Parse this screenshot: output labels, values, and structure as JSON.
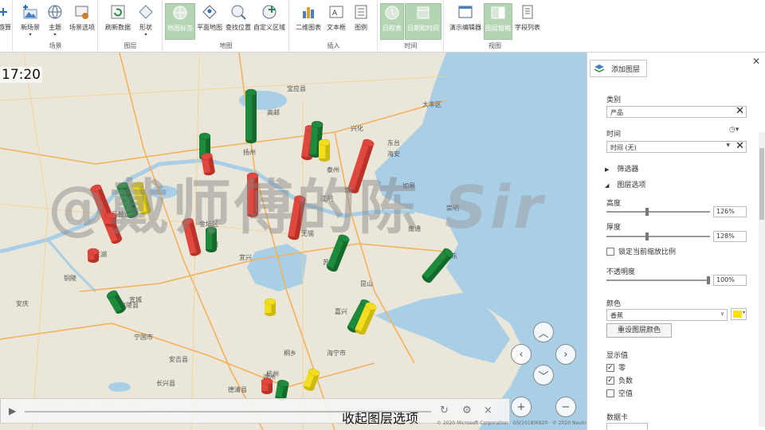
{
  "ribbon": {
    "groups": [
      {
        "label": "场景",
        "buttons": [
          {
            "label": "新场景"
          },
          {
            "label": "主题"
          },
          {
            "label": "场景选项"
          }
        ]
      },
      {
        "label": "图层",
        "buttons": [
          {
            "label": "刷新数据"
          },
          {
            "label": "形状"
          }
        ]
      },
      {
        "label": "地图",
        "buttons": [
          {
            "label": "地图标签"
          },
          {
            "label": "平面地图"
          },
          {
            "label": "查找位置"
          },
          {
            "label": "自定义区域"
          }
        ]
      },
      {
        "label": "插入",
        "buttons": [
          {
            "label": "二维图表"
          },
          {
            "label": "文本框"
          },
          {
            "label": "图例"
          }
        ]
      },
      {
        "label": "时间",
        "buttons": [
          {
            "label": "日程表"
          },
          {
            "label": "日期和时间"
          }
        ]
      },
      {
        "label": "视图",
        "buttons": [
          {
            "label": "演示编辑器"
          },
          {
            "label": "图层窗格"
          },
          {
            "label": "字段列表"
          }
        ]
      }
    ],
    "first_partial_label": "游算"
  },
  "map": {
    "clock": "17:20",
    "watermark": "@戴师傅的陈",
    "watermark_suffix": "Sir",
    "place_labels": [
      "马鞍山",
      "芜湖",
      "宁国市",
      "南陵县",
      "宣城",
      "长兴县",
      "湖州",
      "杭州",
      "德清县",
      "海宁市",
      "嘉兴",
      "苏州",
      "无锡",
      "江阴",
      "常熟",
      "扬州",
      "高邮",
      "宝应县",
      "金坛区",
      "溧阳",
      "宜兴",
      "安吉县",
      "昆山",
      "崇明",
      "海安",
      "如皋",
      "南通",
      "泰州",
      "兴化",
      "大丰区",
      "东台",
      "启东",
      "桐乡",
      "安庆",
      "铜陵"
    ],
    "copyright": "© 2020 Microsoft Corporation · GS(2018)6920 · © 2020 NavInfo"
  },
  "timeline": {
    "subtitle": "收起图层选项"
  },
  "panel": {
    "add_layer": "添加图层",
    "category_label": "类别",
    "category_value": "产品",
    "time_label": "时间",
    "time_value": "时间 (无)",
    "filter_section": "筛选器",
    "layer_options_section": "图层选项",
    "height_label": "高度",
    "height_value": "126%",
    "height_level": 0.39,
    "thickness_label": "厚度",
    "thickness_value": "128%",
    "thickness_level": 0.39,
    "lock_scale": "锁定当前缩放比例",
    "opacity_label": "不透明度",
    "opacity_value": "100%",
    "opacity_level": 1.0,
    "color_label": "颜色",
    "color_value": "香蕉",
    "color_swatch": "#ffe100",
    "reset_color": "重设图层颜色",
    "display_label": "显示值",
    "chk_zero": "零",
    "chk_negative": "负数",
    "chk_null": "空值",
    "data_card": "数据卡"
  },
  "colors": {
    "red": "#e0483e",
    "green": "#1e8a3c",
    "yellow": "#f2de1c",
    "water": "#a9cfe6",
    "land": "#eae6d9",
    "ribbon_active": "#b4d5b4"
  }
}
